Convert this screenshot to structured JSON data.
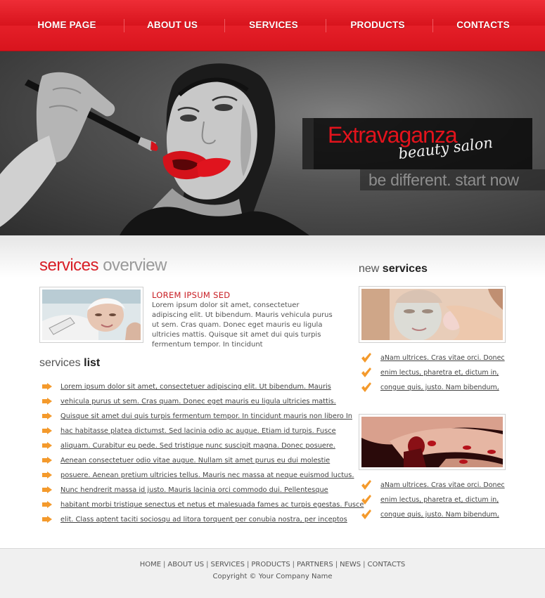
{
  "nav": {
    "items": [
      {
        "label": "HOME PAGE"
      },
      {
        "label": "ABOUT US"
      },
      {
        "label": "SERVICES"
      },
      {
        "label": "PRODUCTS"
      },
      {
        "label": "CONTACTS"
      }
    ]
  },
  "hero": {
    "brand_name": "Extravaganza",
    "brand_sub": "beauty salon",
    "slogan": "be different. start now",
    "image": "woman-lipstick-photo"
  },
  "services_overview": {
    "title_a": "services",
    "title_b": " overview",
    "image": "facial-treatment-photo",
    "heading": "LOREM IPSUM SED",
    "text": "Lorem ipsum dolor sit amet, consectetuer adipiscing elit. Ut bibendum. Mauris vehicula purus ut sem. Cras quam. Donec eget mauris eu ligula ultricies mattis. Quisque sit amet dui quis turpis fermentum tempor. In tincidunt"
  },
  "services_list": {
    "title_a": "services ",
    "title_b": "list",
    "icon": "arrow-bullet-icon",
    "items": [
      "Lorem ipsum dolor sit amet, consectetuer adipiscing elit. Ut bibendum. Mauris",
      "vehicula purus ut sem. Cras quam. Donec eget mauris eu ligula ultricies mattis.",
      "Quisque sit amet dui quis turpis fermentum tempor. In tincidunt mauris non libero In",
      "hac habitasse platea dictumst. Sed lacinia odio ac augue. Etiam id turpis. Fusce",
      "aliquam. Curabitur eu pede. Sed tristique nunc suscipit magna. Donec posuere.",
      "Aenean consectetuer odio vitae augue. Nullam sit amet purus eu dui molestie",
      "posuere. Aenean pretium ultricies tellus. Mauris nec massa at neque euismod luctus.",
      "Nunc hendrerit massa id justo. Mauris lacinia orci commodo dui. Pellentesque",
      "habitant morbi tristique senectus et netus et malesuada fames ac turpis egestas. Fusce",
      "elit. Class aptent taciti sociosqu ad litora torquent per conubia nostra, per inceptos"
    ]
  },
  "new_services": {
    "title_a": "new ",
    "title_b": "services",
    "icon": "check-icon",
    "blocks": [
      {
        "image": "face-mask-photo",
        "items": [
          "aNam ultrices. Cras vitae orci. Donec",
          "enim lectus, pharetra et, dictum in,",
          "congue quis, justo. Nam bibendum,"
        ]
      },
      {
        "image": "manicure-photo",
        "items": [
          "aNam ultrices. Cras vitae orci. Donec",
          "enim lectus, pharetra et, dictum in,",
          "congue quis, justo. Nam bibendum,"
        ]
      }
    ]
  },
  "footer": {
    "links": [
      {
        "label": "HOME"
      },
      {
        "label": "ABOUT US"
      },
      {
        "label": "SERVICES"
      },
      {
        "label": "PRODUCTS"
      },
      {
        "label": "PARTNERS"
      },
      {
        "label": "NEWS"
      },
      {
        "label": "CONTACTS"
      }
    ],
    "separator": "|",
    "copyright": "Copyright © Your Company Name"
  },
  "colors": {
    "accent": "#d81e26",
    "nav_bg": "#e01b24",
    "footer_bg": "#f0f0f0"
  }
}
